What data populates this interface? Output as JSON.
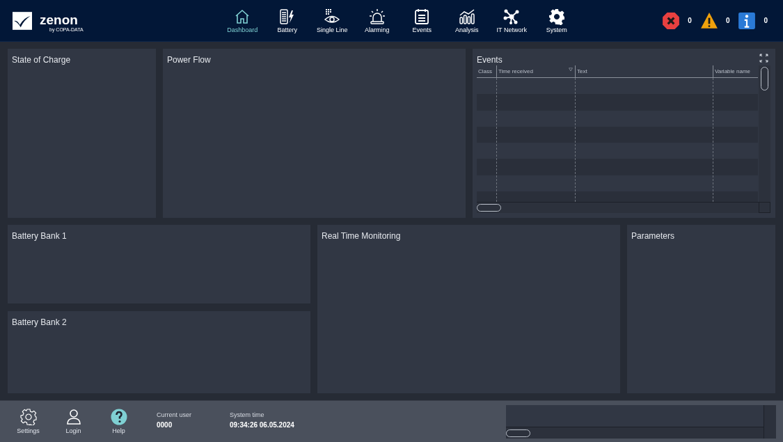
{
  "header": {
    "logo": {
      "name": "zenon",
      "byline": "by COPA-DATA"
    },
    "nav": [
      {
        "kind": "home",
        "label": "Dashboard",
        "selected": true
      },
      {
        "kind": "battery",
        "label": "Battery",
        "selected": false
      },
      {
        "kind": "eye",
        "label": "Single Line",
        "selected": false
      },
      {
        "kind": "siren",
        "label": "Alarming",
        "selected": false
      },
      {
        "kind": "calendar",
        "label": "Events",
        "selected": false
      },
      {
        "kind": "chart",
        "label": "Analysis",
        "selected": false
      },
      {
        "kind": "network",
        "label": "IT Network",
        "selected": false
      },
      {
        "kind": "gear",
        "label": "System",
        "selected": false
      }
    ],
    "alarms": [
      {
        "kind": "error",
        "count": "0"
      },
      {
        "kind": "warning",
        "count": "0"
      },
      {
        "kind": "info",
        "count": "0"
      }
    ]
  },
  "panels": {
    "state_of_charge": "State of Charge",
    "power_flow": "Power Flow",
    "events": {
      "title": "Events",
      "columns": [
        "Class",
        "Time received",
        "Text",
        "Variable name"
      ]
    },
    "battery_bank_1": "Battery Bank 1",
    "battery_bank_2": "Battery Bank 2",
    "real_time_monitoring": "Real Time Monitoring",
    "parameters": "Parameters"
  },
  "footer": {
    "buttons": [
      {
        "kind": "settings",
        "label": "Settings"
      },
      {
        "kind": "login",
        "label": "Login"
      },
      {
        "kind": "help",
        "label": "Help"
      }
    ],
    "current_user": {
      "label": "Current user",
      "value": "0000"
    },
    "system_time": {
      "label": "System time",
      "value": "09:34:26 06.05.2024"
    }
  }
}
